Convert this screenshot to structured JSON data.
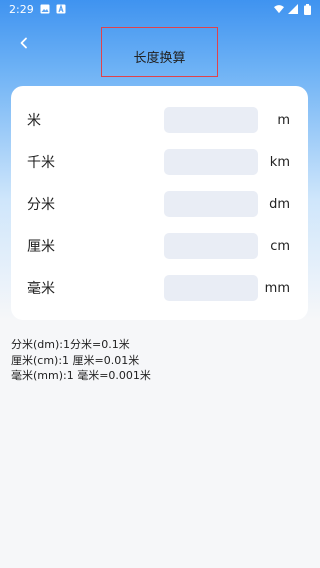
{
  "status_bar": {
    "time": "2:29",
    "icons": [
      "image-icon",
      "font-icon",
      "wifi-icon",
      "signal-icon",
      "battery-icon"
    ]
  },
  "header": {
    "title": "长度换算",
    "back_icon": "chevron-left-icon"
  },
  "converter": {
    "rows": [
      {
        "label": "米",
        "unit": "m",
        "value": ""
      },
      {
        "label": "千米",
        "unit": "km",
        "value": ""
      },
      {
        "label": "分米",
        "unit": "dm",
        "value": ""
      },
      {
        "label": "厘米",
        "unit": "cm",
        "value": ""
      },
      {
        "label": "毫米",
        "unit": "mm",
        "value": ""
      }
    ]
  },
  "notes": [
    "分米(dm):1分米=0.1米",
    "厘米(cm):1 厘米=0.01米",
    "毫米(mm):1 毫米=0.001米"
  ],
  "colors": {
    "accent": "#3f93f0",
    "title_border": "#e0424b",
    "input_bg": "#e9edf5"
  }
}
